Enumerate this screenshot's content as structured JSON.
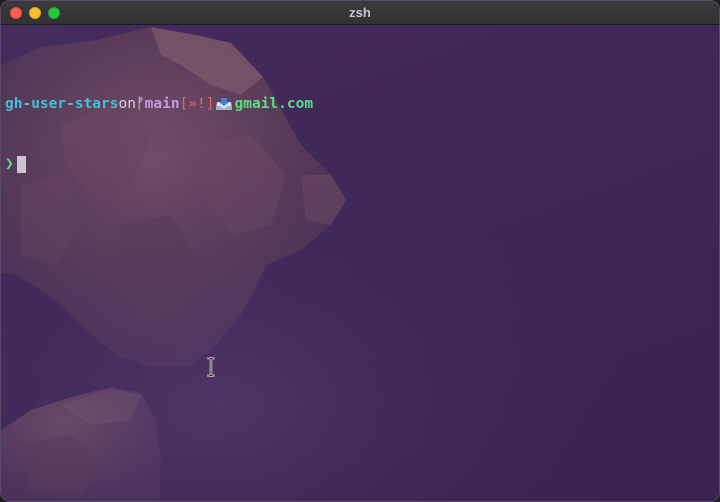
{
  "window": {
    "title": "zsh"
  },
  "prompt": {
    "directory": "gh-user-stars",
    "on_word": "on",
    "branch_icon": "ᚠ",
    "branch": "main",
    "git_status": "[»!]",
    "mail_icon": "inbox-tray-icon",
    "email": "gmail.com",
    "prompt_symbol": "❯"
  },
  "colors": {
    "background": "#3d2754",
    "directory": "#43c1d8",
    "branch": "#c49ae0",
    "git_status": "#e06a6a",
    "email": "#5cdc84"
  }
}
